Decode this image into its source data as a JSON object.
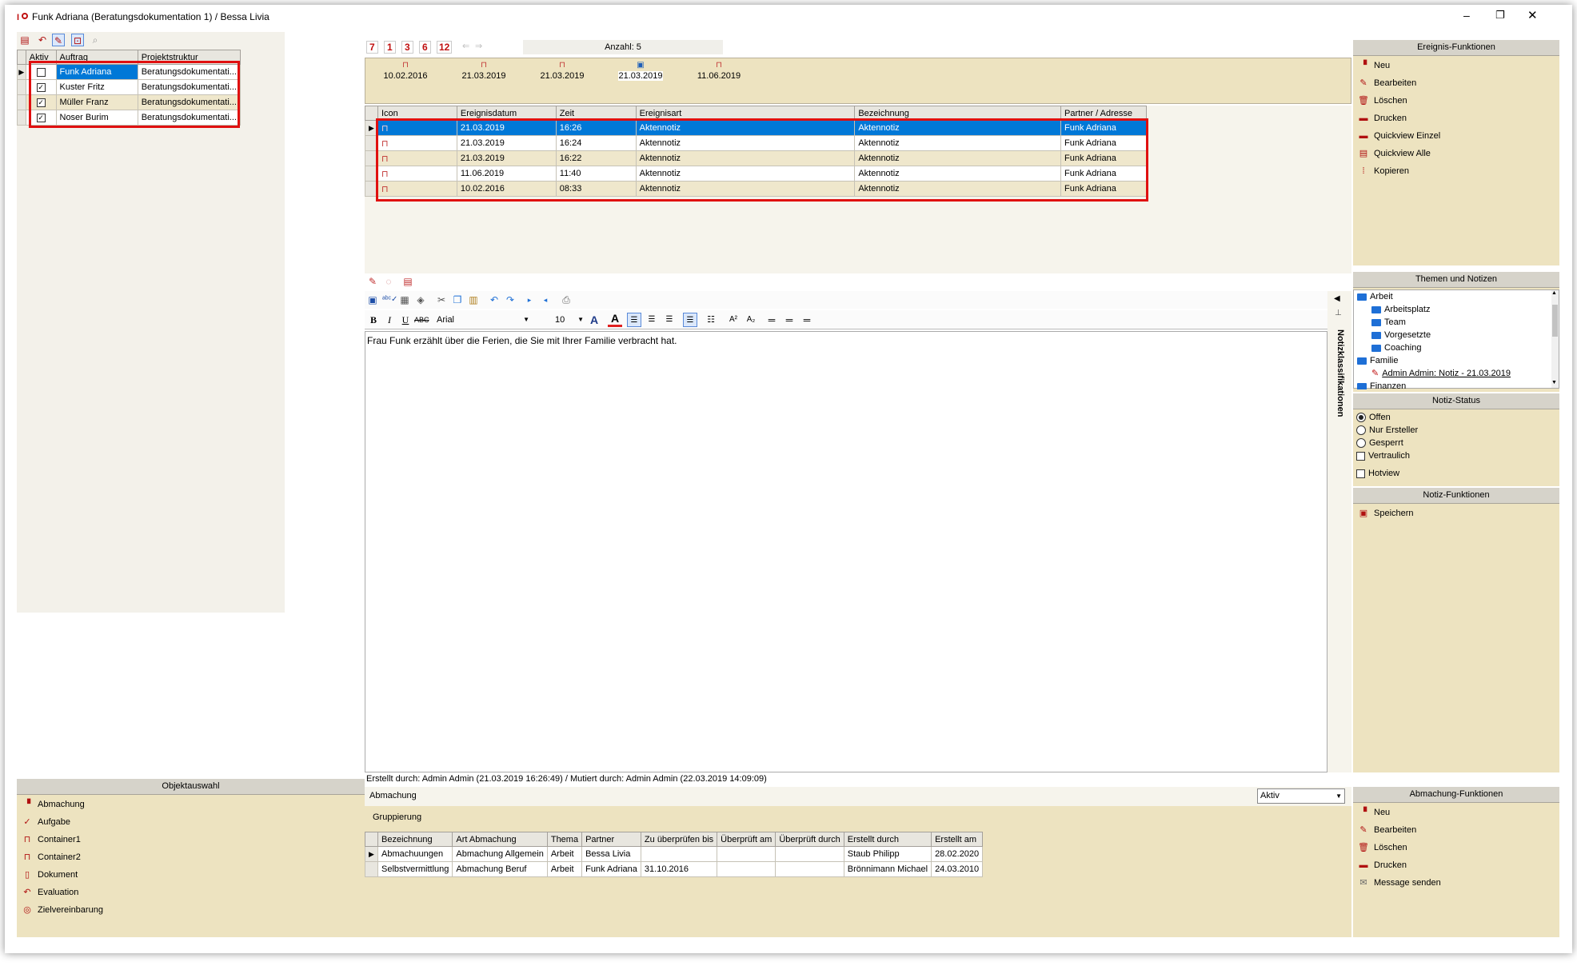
{
  "window": {
    "title": "Funk Adriana (Beratungsdokumentation 1) / Bessa Livia",
    "minimize": "–",
    "restore": "❐",
    "close": "✕"
  },
  "toolbar_top_right": {
    "btn7": "7",
    "btn1": "1",
    "btn3": "3",
    "btn6": "6",
    "btn12": "12",
    "count_label": "Anzahl: 5"
  },
  "timeline_dates": [
    "10.02.2016",
    "21.03.2019",
    "21.03.2019",
    "21.03.2019",
    "11.06.2019"
  ],
  "auftrag_table": {
    "headers": [
      "Aktiv",
      "Auftrag",
      "Projektstruktur"
    ],
    "rows": [
      {
        "auftrag": "Funk Adriana",
        "projekt": "Beratungsdokumentati..."
      },
      {
        "auftrag": "Kuster Fritz",
        "projekt": "Beratungsdokumentati..."
      },
      {
        "auftrag": "Müller Franz",
        "projekt": "Beratungsdokumentati..."
      },
      {
        "auftrag": "Noser Burim",
        "projekt": "Beratungsdokumentati..."
      }
    ]
  },
  "event_table": {
    "headers": [
      "Icon",
      "Ereignisdatum",
      "Zeit",
      "Ereignisart",
      "Bezeichnung",
      "Partner / Adresse"
    ],
    "rows": [
      {
        "datum": "21.03.2019",
        "zeit": "16:26",
        "art": "Aktennotiz",
        "bez": "Aktennotiz",
        "partner": "Funk Adriana"
      },
      {
        "datum": "21.03.2019",
        "zeit": "16:24",
        "art": "Aktennotiz",
        "bez": "Aktennotiz",
        "partner": "Funk Adriana"
      },
      {
        "datum": "21.03.2019",
        "zeit": "16:22",
        "art": "Aktennotiz",
        "bez": "Aktennotiz",
        "partner": "Funk Adriana"
      },
      {
        "datum": "11.06.2019",
        "zeit": "11:40",
        "art": "Aktennotiz",
        "bez": "Aktennotiz",
        "partner": "Funk Adriana"
      },
      {
        "datum": "10.02.2016",
        "zeit": "08:33",
        "art": "Aktennotiz",
        "bez": "Aktennotiz",
        "partner": "Funk Adriana"
      }
    ]
  },
  "editor": {
    "font_name": "Arial",
    "font_size": "10",
    "text": "Frau Funk erzählt über die Ferien, die Sie mit Ihrer Familie verbracht hat.",
    "side_tab": "Notizklassifikationen",
    "meta": "Erstellt durch: Admin Admin (21.03.2019 16:26:49) / Mutiert durch: Admin Admin (22.03.2019 14:09:09)"
  },
  "ereignis_funktionen": {
    "title": "Ereignis-Funktionen",
    "items": [
      "Neu",
      "Bearbeiten",
      "Löschen",
      "Drucken",
      "Quickview Einzel",
      "Quickview Alle",
      "Kopieren"
    ]
  },
  "themen": {
    "title": "Themen und Notizen",
    "tree": [
      {
        "label": "Arbeit",
        "level": 0
      },
      {
        "label": "Arbeitsplatz",
        "level": 1
      },
      {
        "label": "Team",
        "level": 1
      },
      {
        "label": "Vorgesetzte",
        "level": 1
      },
      {
        "label": "Coaching",
        "level": 1
      },
      {
        "label": "Familie",
        "level": 0
      },
      {
        "label": "Admin Admin: Notiz - 21.03.2019",
        "level": 1
      },
      {
        "label": "Finanzen",
        "level": 0
      }
    ]
  },
  "notiz_status": {
    "title": "Notiz-Status",
    "offen": "Offen",
    "nur_ersteller": "Nur Ersteller",
    "gesperrt": "Gesperrt",
    "vertraulich": "Vertraulich",
    "hotview": "Hotview"
  },
  "notiz_funktionen": {
    "title": "Notiz-Funktionen",
    "speichern": "Speichern"
  },
  "objektauswahl": {
    "title": "Objektauswahl",
    "items": [
      "Abmachung",
      "Aufgabe",
      "Container1",
      "Container2",
      "Dokument",
      "Evaluation",
      "Zielvereinbarung"
    ]
  },
  "abmachung": {
    "label": "Abmachung",
    "filter_value": "Aktiv",
    "gruppierung": "Gruppierung",
    "headers": [
      "Bezeichnung",
      "Art Abmachung",
      "Thema",
      "Partner",
      "Zu überprüfen bis",
      "Überprüft am",
      "Überprüft durch",
      "Erstellt durch",
      "Erstellt am"
    ],
    "rows": [
      [
        "Abmachuungen",
        "Abmachung Allgemein",
        "Arbeit",
        "Bessa Livia",
        "",
        "",
        "",
        "Staub Philipp",
        "28.02.2020"
      ],
      [
        "Selbstvermittlung",
        "Abmachung Beruf",
        "Arbeit",
        "Funk Adriana",
        "31.10.2016",
        "",
        "",
        "Brönnimann Michael",
        "24.03.2010"
      ]
    ]
  },
  "abmachung_funktionen": {
    "title": "Abmachung-Funktionen",
    "items": [
      "Neu",
      "Bearbeiten",
      "Löschen",
      "Drucken",
      "Message senden"
    ]
  },
  "colors": {
    "panel_tan": "#ede3c0",
    "selection": "#0078d7",
    "highlight_box": "#e01010",
    "folder_blue": "#1e6fd6"
  }
}
